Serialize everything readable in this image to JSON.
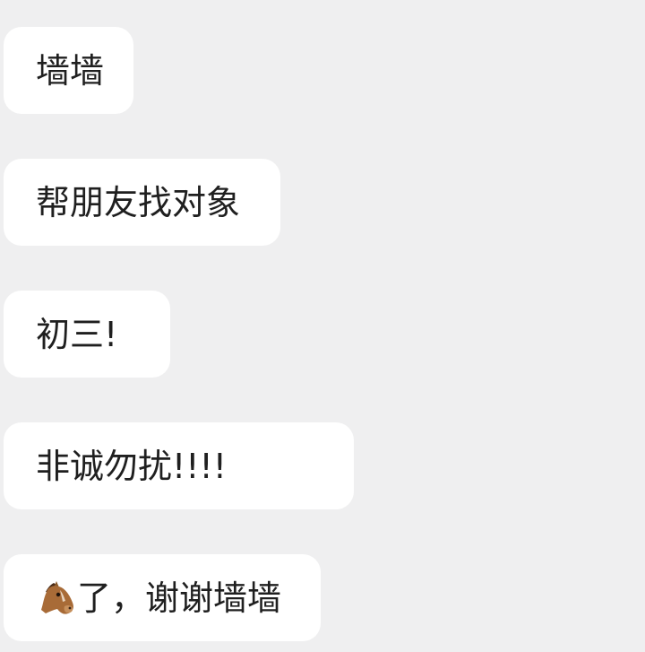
{
  "messages": [
    {
      "text": "墙墙"
    },
    {
      "text": "帮朋友找对象"
    },
    {
      "text": "初三!"
    },
    {
      "text": "非诚勿扰!!!!"
    },
    {
      "icon": "horse-emoji-icon",
      "text": "了，谢谢墙墙"
    }
  ],
  "colors": {
    "background": "#efeff0",
    "bubble": "#ffffff",
    "text": "#1f1f1f"
  }
}
